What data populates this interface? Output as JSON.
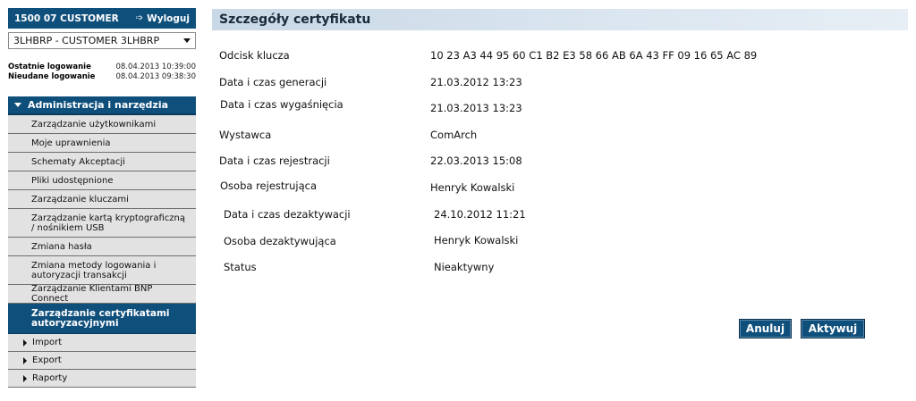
{
  "session": {
    "user": "1500 07 CUSTOMER",
    "logout_label": "Wyloguj",
    "client": "3LHBRP - CUSTOMER 3LHBRP"
  },
  "login_info": {
    "last_label": "Ostatnie logowanie",
    "last_value": "08.04.2013 10:39:00",
    "failed_label": "Nieudane logowanie",
    "failed_value": "08.04.2013 09:38:30"
  },
  "menu": {
    "header": "Administracja i narzędzia",
    "items": [
      "Zarządzanie użytkownikami",
      "Moje uprawnienia",
      "Schematy Akceptacji",
      "Pliki udostępnione",
      "Zarządzanie kluczami",
      "Zarządzanie kartą kryptograficzną / nośnikiem USB",
      "Zmiana hasła",
      "Zmiana metody logowania i autoryzacji transakcji",
      "Zarządzanie Klientami BNP Connect",
      "Zarządzanie certyfikatami autoryzacyjnymi"
    ],
    "subitems": [
      "Import",
      "Export",
      "Raporty"
    ]
  },
  "page": {
    "title": "Szczegóły certyfikatu"
  },
  "details": [
    {
      "label": "Odcisk klucza",
      "value": "10 23 A3 44 95 60 C1 B2 E3 58 66 AB 6A 43 FF 09 16 65 AC 89"
    },
    {
      "label": "Data i czas generacji",
      "value": "21.03.2012 13:23"
    },
    {
      "label": "Data i czas wygaśnięcia",
      "value": "21.03.2013 13:23"
    },
    {
      "label": "Wystawca",
      "value": "ComArch"
    },
    {
      "label": "Data i czas rejestracji",
      "value": "22.03.2013 15:08"
    },
    {
      "label": "Osoba rejestrująca",
      "value": "Henryk Kowalski"
    },
    {
      "label": "Data i czas dezaktywacji",
      "value": "24.10.2012 11:21"
    },
    {
      "label": "Osoba dezaktywująca",
      "value": "Henryk Kowalski"
    },
    {
      "label": "Status",
      "value": "Nieaktywny"
    }
  ],
  "actions": {
    "cancel": "Anuluj",
    "activate": "Aktywuj"
  }
}
